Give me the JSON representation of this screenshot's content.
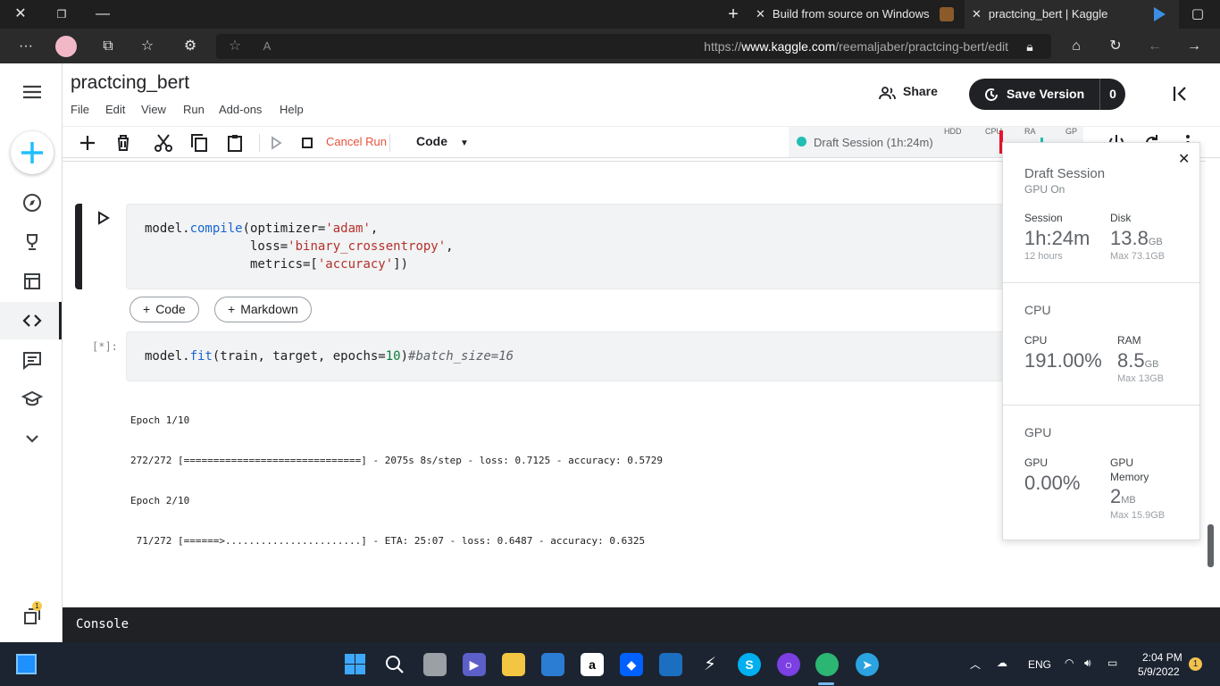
{
  "browser": {
    "tabs": [
      {
        "title": "Build from source on Windows",
        "active": false
      },
      {
        "title": "practcing_bert | Kaggle",
        "active": true
      }
    ],
    "url_prefix": "https://",
    "url_domain": "www.kaggle.com",
    "url_path": "/reemaljaber/practcing-bert/edit"
  },
  "notebook": {
    "title": "practcing_bert",
    "menu": [
      "File",
      "Edit",
      "View",
      "Run",
      "Add-ons",
      "Help"
    ],
    "share_label": "Share",
    "save_label": "Save Version",
    "save_count": "0"
  },
  "toolbar": {
    "cancel_label": "Cancel Run",
    "cell_type": "Code",
    "session_label": "Draft Session (1h:24m)",
    "labels": {
      "hdd": "HDD",
      "cpu": "CPU",
      "ram": "RA",
      "gpu": "GP"
    }
  },
  "cells": {
    "cell1_line1_a": "model.",
    "cell1_line1_fn": "compile",
    "cell1_line1_b": "(optimizer=",
    "cell1_line1_str": "'adam'",
    "cell1_line1_c": ",",
    "cell1_line2_a": "              loss=",
    "cell1_line2_str": "'binary_crossentropy'",
    "cell1_line2_c": ",",
    "cell1_line3_a": "              metrics=[",
    "cell1_line3_str": "'accuracy'",
    "cell1_line3_c": "])",
    "add_code": "Code",
    "add_markdown": "Markdown",
    "cell2_prompt": "[*]:",
    "cell2_a": "model.",
    "cell2_fn": "fit",
    "cell2_b": "(train, target, epochs=",
    "cell2_num": "10",
    "cell2_c": ")",
    "cell2_comment": "#batch_size=16",
    "output": [
      "Epoch 1/10",
      "272/272 [==============================] - 2075s 8s/step - loss: 0.7125 - accuracy: 0.5729",
      "Epoch 2/10",
      " 71/272 [======>.......................] - ETA: 25:07 - loss: 0.6487 - accuracy: 0.6325"
    ]
  },
  "popup": {
    "title": "Draft Session",
    "subtitle": "GPU On",
    "session_label": "Session",
    "session_value": "1h:24m",
    "session_sub": "12 hours",
    "disk_label": "Disk",
    "disk_value": "13.8",
    "disk_unit": "GB",
    "disk_sub": "Max 73.1GB",
    "cpu_heading": "CPU",
    "cpu_label": "CPU",
    "cpu_value": "191.00%",
    "ram_label": "RAM",
    "ram_value": "8.5",
    "ram_unit": "GB",
    "ram_sub": "Max 13GB",
    "gpu_heading": "GPU",
    "gpu_label": "GPU",
    "gpu_value": "0.00%",
    "gpumem_label_1": "GPU",
    "gpumem_label_2": "Memory",
    "gpumem_value": "2",
    "gpumem_unit": "MB",
    "gpumem_sub": "Max 15.9GB"
  },
  "console_label": "Console",
  "taskbar": {
    "lang": "ENG",
    "time": "2:04 PM",
    "date": "5/9/2022",
    "notif_count": "1",
    "rail_badge": "1"
  },
  "colors": {
    "accent_green": "#20beb4",
    "cancel_red": "#e5533c",
    "save_bg": "#202124"
  }
}
